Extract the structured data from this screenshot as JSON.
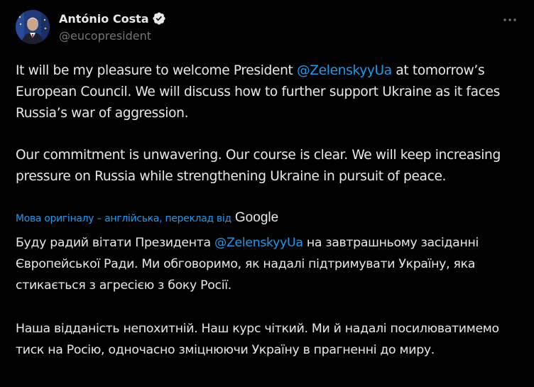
{
  "author": {
    "display_name": "António Costa",
    "handle": "@eucopresident",
    "verified": true
  },
  "colors": {
    "background": "#000000",
    "text": "#e7e9ea",
    "secondary": "#71767b",
    "accent": "#1d9bf0"
  },
  "icons": {
    "more": "more-options-icon",
    "verified": "verified-badge-icon"
  },
  "original": {
    "p1_before": "It will be my pleasure to welcome President ",
    "p1_mention": "@ZelenskyyUa",
    "p1_after": " at tomorrow’s European Council. We will discuss how to further support Ukraine as it faces Russia’s war of aggression.",
    "p2": "Our commitment is unwavering. Our course is clear. We will keep increasing pressure on Russia while strengthening Ukraine in pursuit of peace."
  },
  "translation": {
    "label": "Мова оригіналу – англійська, переклад від",
    "provider": "Google",
    "p1_before": "Буду радий вітати Президента ",
    "p1_mention": "@ZelenskyyUa",
    "p1_after": " на завтрашньому засіданні Європейської Ради. Ми обговоримо, як надалі підтримувати Україну, яка стикається з агресією з боку Росії.",
    "p2": "Наша відданість непохитній. Наш курс чіткий. Ми й надалі посилюватимемо тиск на Росію, одночасно зміцнюючи Україну в прагненні до миру."
  }
}
